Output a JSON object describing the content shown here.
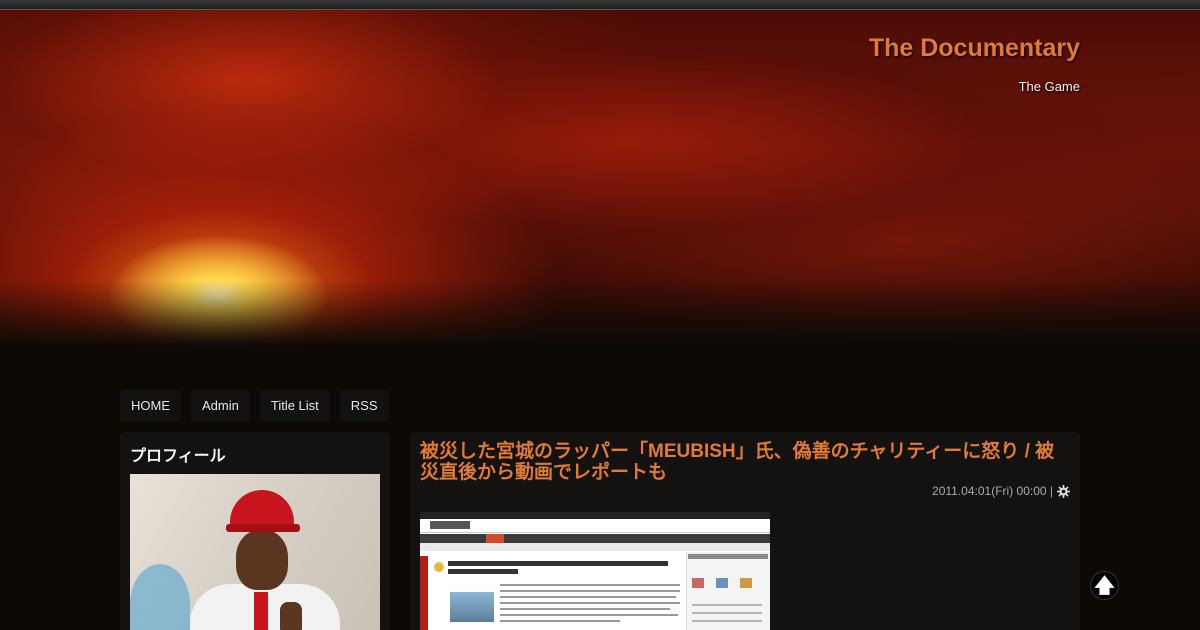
{
  "site": {
    "title": "The Documentary",
    "subtitle": "The Game"
  },
  "nav": {
    "items": [
      {
        "label": "HOME"
      },
      {
        "label": "Admin"
      },
      {
        "label": "Title List"
      },
      {
        "label": "RSS"
      }
    ]
  },
  "sidebar": {
    "profile_title": "プロフィール"
  },
  "entry": {
    "title": "被災した宮城のラッパー「MEUBISH」氏、偽善のチャリティーに怒り / 被災直後から動画でレポートも",
    "date": "2011.04:01(Fri) 00:00 |"
  },
  "icons": {
    "gear": "gear-icon",
    "to_top": "arrow-up-icon"
  },
  "colors": {
    "title_accent": "#e07a34",
    "panel_bg": "#141210",
    "page_bg": "#0d0a06"
  }
}
